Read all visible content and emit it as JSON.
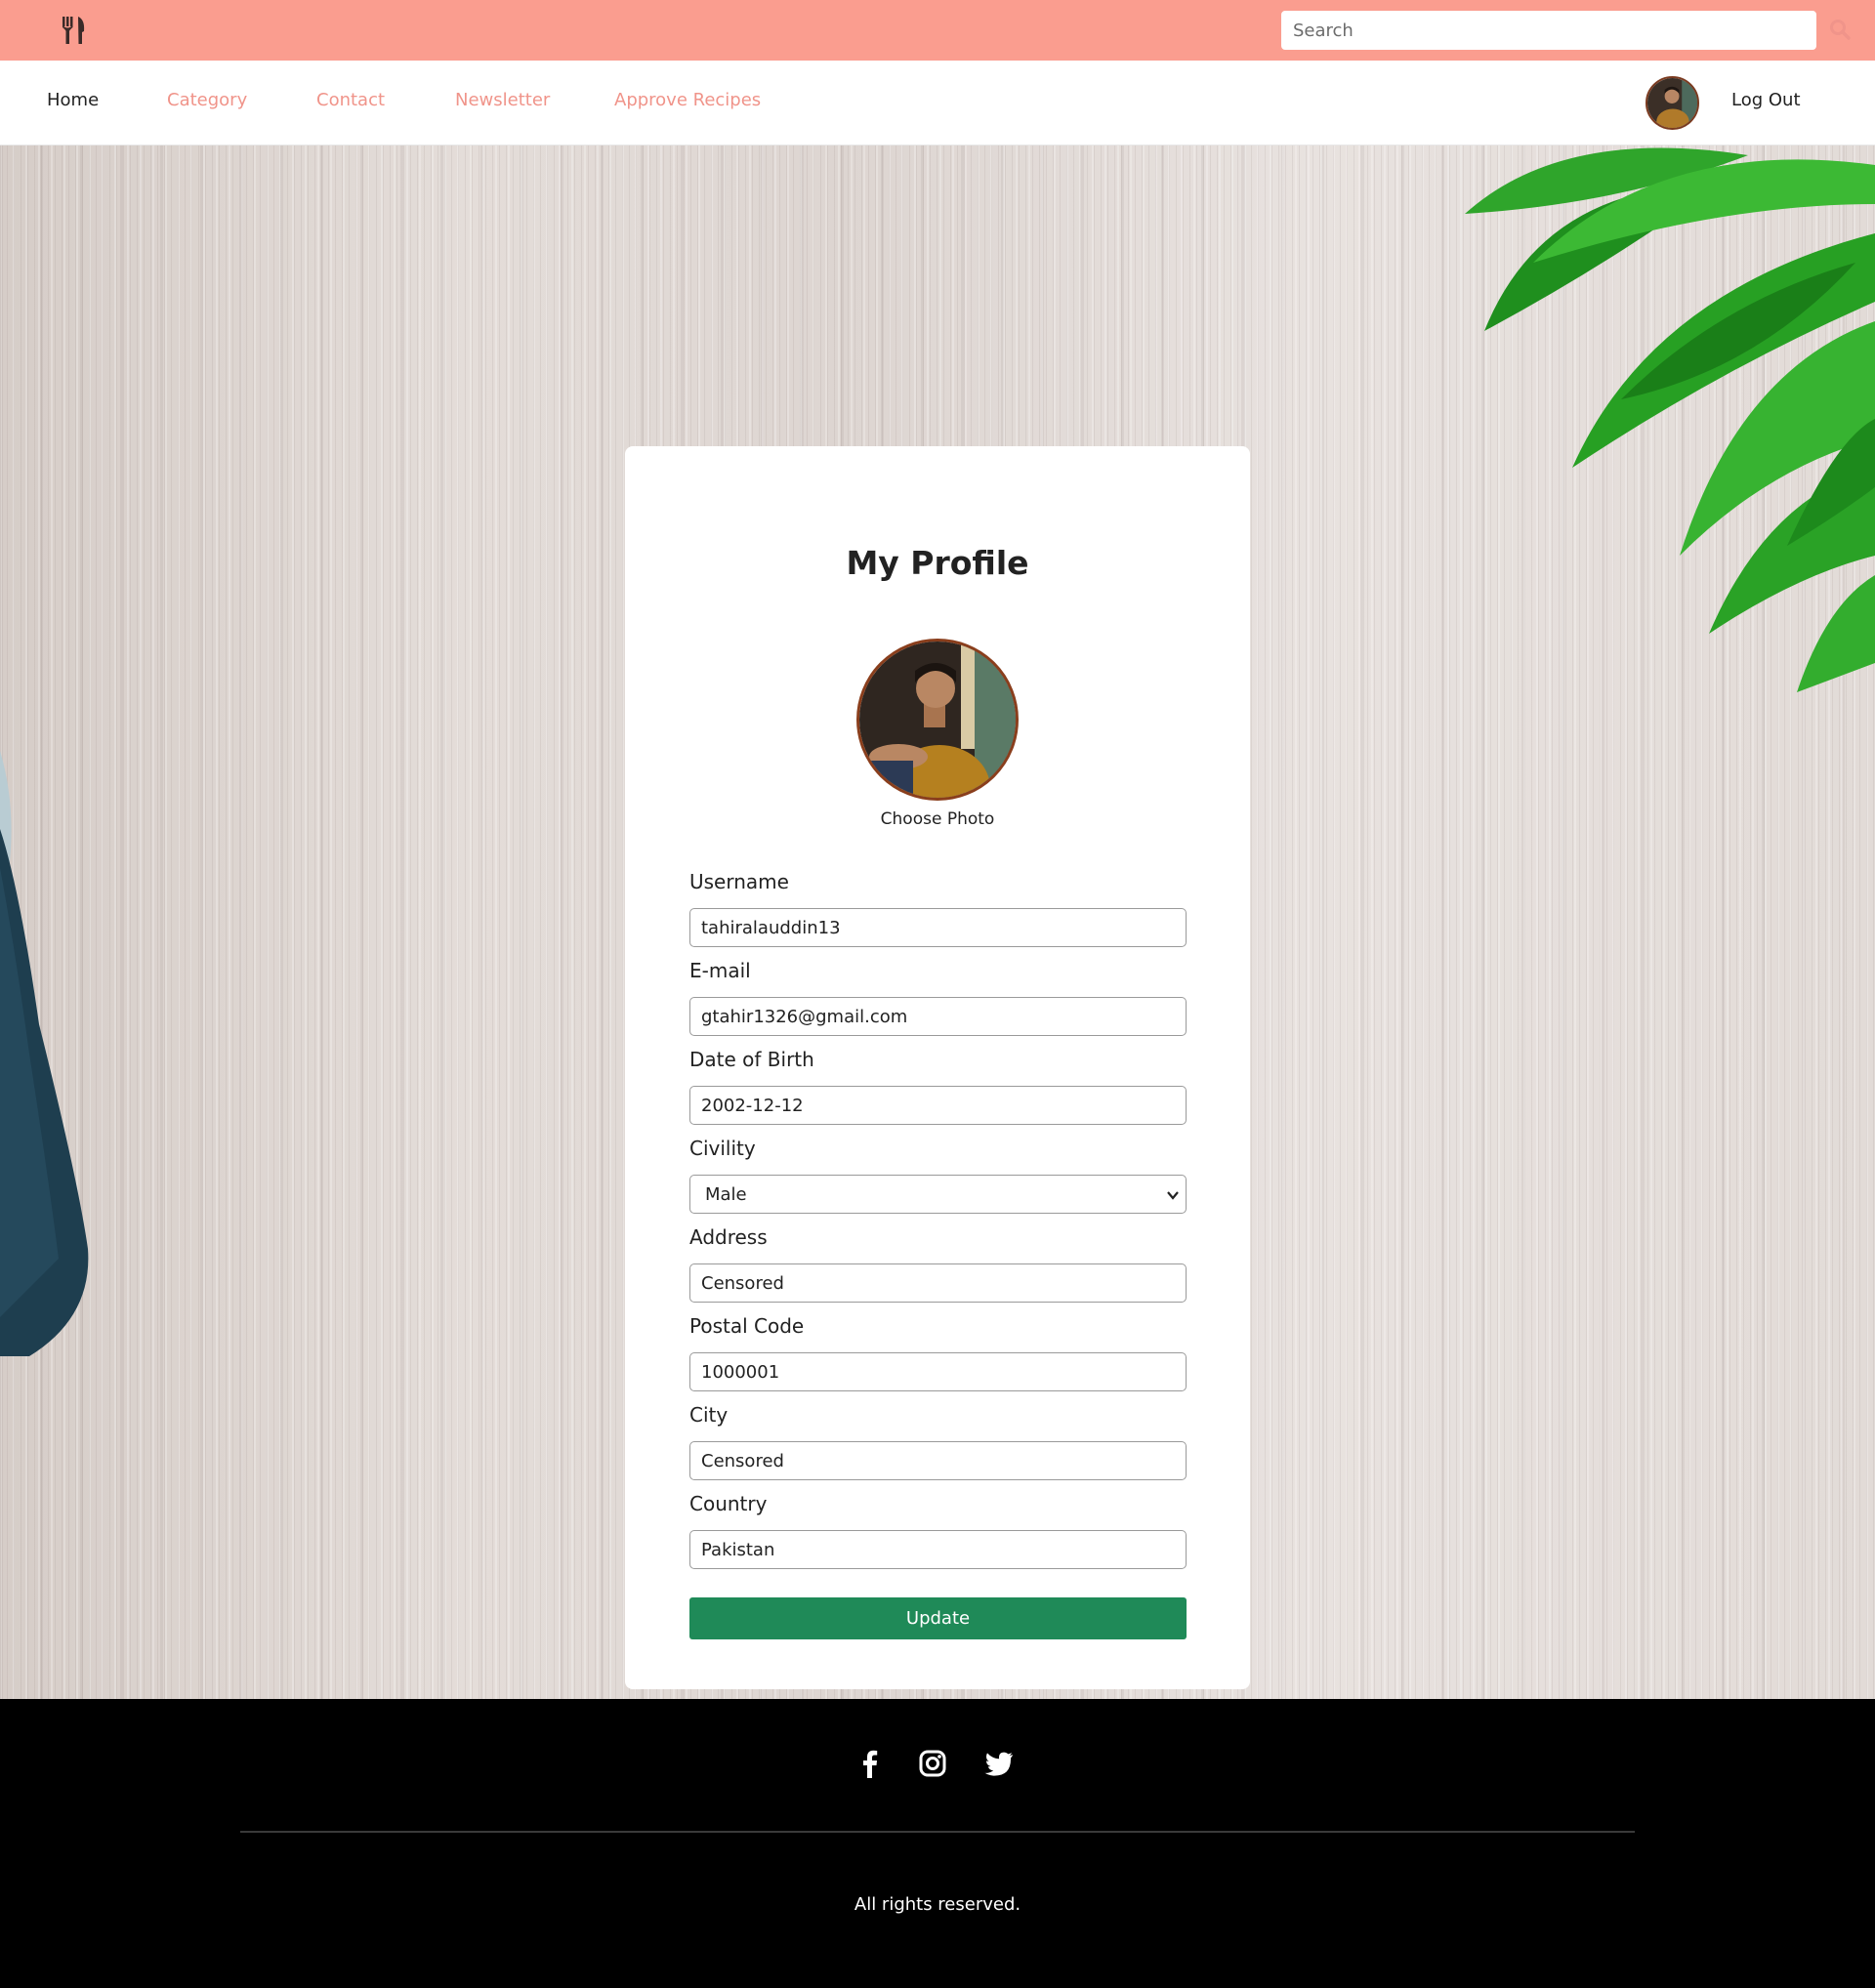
{
  "topbar": {
    "logo_icon": "fork-knife-icon",
    "search": {
      "placeholder": "Search",
      "value": ""
    },
    "search_icon": "search-icon",
    "colors": {
      "background": "#fa9d8f",
      "accent": "#f0948a"
    }
  },
  "nav": {
    "items": [
      {
        "label": "Home",
        "active": true
      },
      {
        "label": "Category",
        "active": false
      },
      {
        "label": "Contact",
        "active": false
      },
      {
        "label": "Newsletter",
        "active": false
      },
      {
        "label": "Approve Recipes",
        "active": false
      }
    ],
    "logout_label": "Log Out"
  },
  "profile": {
    "title": "My Profile",
    "choose_photo_label": "Choose Photo",
    "fields": {
      "username": {
        "label": "Username",
        "value": "tahiralauddin13"
      },
      "email": {
        "label": "E-mail",
        "value": "gtahir1326@gmail.com"
      },
      "dob": {
        "label": "Date of Birth",
        "value": "2002-12-12"
      },
      "civility": {
        "label": "Civility",
        "value": "Male"
      },
      "address": {
        "label": "Address",
        "value": "Censored"
      },
      "postal_code": {
        "label": "Postal Code",
        "value": "1000001"
      },
      "city": {
        "label": "City",
        "value": "Censored"
      },
      "country": {
        "label": "Country",
        "value": "Pakistan"
      }
    },
    "update_label": "Update",
    "update_color": "#1f8a58"
  },
  "footer": {
    "social_icons": [
      "facebook-icon",
      "instagram-icon",
      "twitter-icon"
    ],
    "copyright": "All rights reserved."
  }
}
